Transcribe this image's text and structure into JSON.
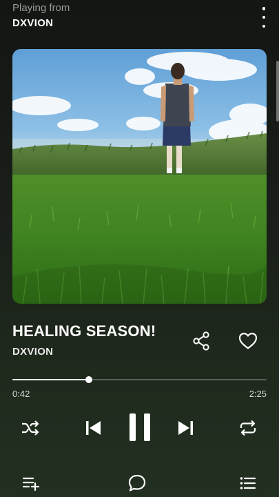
{
  "header": {
    "playing_from_label": "Playing from",
    "source_name": "DXVION",
    "more_icon": "more-vertical-icon"
  },
  "artwork": {
    "description_icon": "album-artwork"
  },
  "track": {
    "title": "HEALING SEASON!",
    "artist": "DXVION",
    "share_icon": "share-icon",
    "like_icon": "heart-outline-icon"
  },
  "playback": {
    "elapsed": "0:42",
    "total": "2:25",
    "progress_fraction": 0.3
  },
  "controls": {
    "shuffle_icon": "shuffle-icon",
    "previous_icon": "skip-previous-icon",
    "pause_icon": "pause-icon",
    "next_icon": "skip-next-icon",
    "repeat_icon": "repeat-icon"
  },
  "bottom_bar": {
    "queue_icon": "add-to-queue-icon",
    "comment_icon": "comment-icon",
    "list_icon": "list-icon"
  },
  "colors": {
    "background_top": "#131613",
    "background_bottom": "#223021",
    "accent": "#ffffff",
    "muted_text": "#9a9d99"
  }
}
